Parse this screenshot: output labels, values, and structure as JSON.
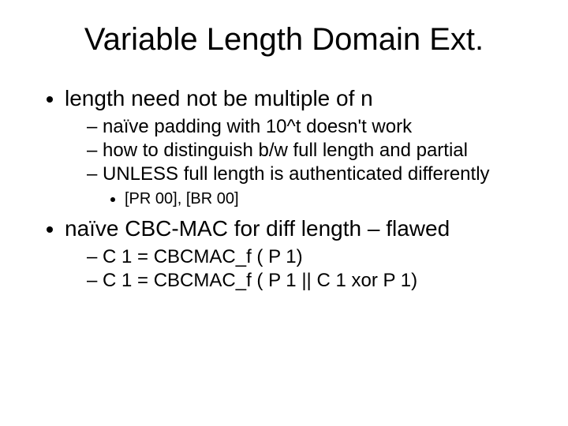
{
  "title": "Variable Length Domain Ext.",
  "bullets": [
    {
      "text": "length need not be multiple of n",
      "children": [
        {
          "text": "naïve padding with 10^t  doesn't work"
        },
        {
          "text": "how to distinguish b/w full length and partial"
        },
        {
          "text": "UNLESS full length is authenticated differently",
          "children": [
            {
              "text": "[PR 00], [BR 00]"
            }
          ]
        }
      ]
    },
    {
      "text": "naïve  CBC-MAC for diff length – flawed",
      "children": [
        {
          "text": " C 1 = CBCMAC_f ( P 1)"
        },
        {
          "text": " C 1 = CBCMAC_f ( P 1 || C 1 xor P 1)"
        }
      ]
    }
  ]
}
